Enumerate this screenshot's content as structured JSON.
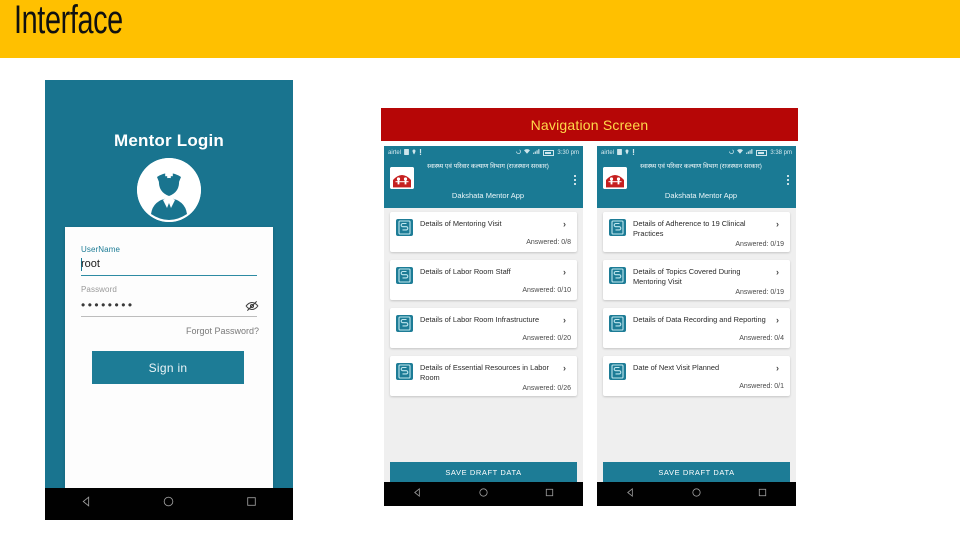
{
  "slide": {
    "title": "Interface",
    "banner_color": "#ffc000"
  },
  "login_screen": {
    "heading": "Mentor Login",
    "avatar_icon": "nurse-avatar-icon",
    "background_color": "#19748f",
    "username": {
      "label": "UserName",
      "value": "root"
    },
    "password": {
      "label": "Password",
      "value": "••••••••",
      "reveal_icon": "eye-off-icon"
    },
    "forgot_label": "Forgot Password?",
    "signin_label": "Sign in",
    "navbar": {
      "back_icon": "back-triangle-icon",
      "home_icon": "home-circle-icon",
      "recents_icon": "recents-square-icon"
    }
  },
  "navigation_section": {
    "banner_label": "Navigation Screen",
    "banner_color": "#b60606",
    "banner_text_color": "#ffd94a"
  },
  "phones": [
    {
      "id": "phone-mid",
      "statusbar": {
        "carrier": "airtel",
        "time": "3:30 pm",
        "icons": [
          "sim-icon",
          "location-icon",
          "alarm-icon",
          "rotate-icon",
          "wifi-icon",
          "signal-icon",
          "battery-icon"
        ]
      },
      "appbar": {
        "logo_icon": "govt-emblem-icon",
        "hindi_title": "स्वास्थ्य एवं परिवार कल्याण विभाग (राजस्थान सरकार)",
        "app_name": "Dakshata Mentor App",
        "overflow_icon": "kebab-menu-icon"
      },
      "items": [
        {
          "title": "Details of Mentoring Visit",
          "answered": "Answered: 0/8",
          "icon": "form-icon",
          "chevron": "chevron-right-icon"
        },
        {
          "title": "Details of Labor Room Staff",
          "answered": "Answered: 0/10",
          "icon": "form-icon",
          "chevron": "chevron-right-icon"
        },
        {
          "title": "Details of Labor Room Infrastructure",
          "answered": "Answered: 0/20",
          "icon": "form-icon",
          "chevron": "chevron-right-icon"
        },
        {
          "title": "Details of Essential Resources in Labor Room",
          "answered": "Answered: 0/26",
          "icon": "form-icon",
          "chevron": "chevron-right-icon"
        }
      ],
      "draft_label": "SAVE DRAFT DATA"
    },
    {
      "id": "phone-right",
      "statusbar": {
        "carrier": "airtel",
        "time": "3:38 pm",
        "icons": [
          "sim-icon",
          "location-icon",
          "alarm-icon",
          "rotate-icon",
          "wifi-icon",
          "signal-icon",
          "battery-icon"
        ]
      },
      "appbar": {
        "logo_icon": "govt-emblem-icon",
        "hindi_title": "स्वास्थ्य एवं परिवार कल्याण विभाग (राजस्थान सरकार)",
        "app_name": "Dakshata Mentor App",
        "overflow_icon": "kebab-menu-icon"
      },
      "items": [
        {
          "title": "Details of Adherence to 19 Clinical Practices",
          "answered": "Answered: 0/19",
          "icon": "form-icon",
          "chevron": "chevron-right-icon"
        },
        {
          "title": "Details of Topics Covered During Mentoring Visit",
          "answered": "Answered: 0/19",
          "icon": "form-icon",
          "chevron": "chevron-right-icon"
        },
        {
          "title": "Details of Data Recording and Reporting",
          "answered": "Answered: 0/4",
          "icon": "form-icon",
          "chevron": "chevron-right-icon"
        },
        {
          "title": "Date of Next Visit Planned",
          "answered": "Answered: 0/1",
          "icon": "form-icon",
          "chevron": "chevron-right-icon"
        }
      ],
      "draft_label": "SAVE DRAFT DATA"
    }
  ],
  "colors": {
    "teal": "#1d7c96",
    "yellow": "#ffc000",
    "red": "#b60606"
  }
}
